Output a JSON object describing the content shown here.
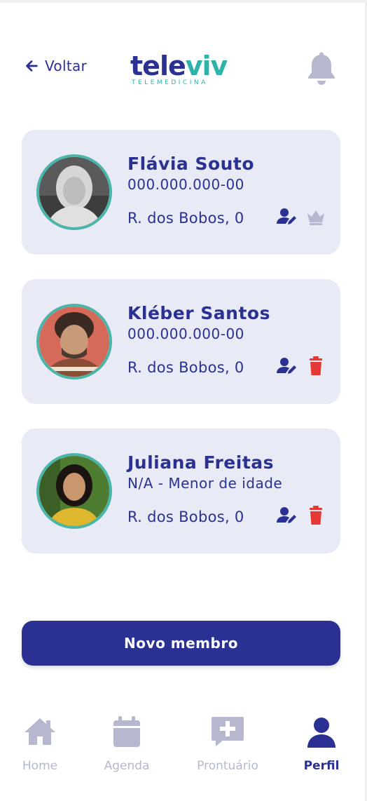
{
  "header": {
    "back_label": "Voltar",
    "logo_main_1": "tele",
    "logo_main_2": "viv",
    "logo_sub": "TELEMEDICINA"
  },
  "members": [
    {
      "name": "Flávia Souto",
      "document": "000.000.000-00",
      "address": "R. dos Bobos, 0",
      "actions": [
        "edit-user-icon",
        "crown-icon"
      ]
    },
    {
      "name": "Kléber Santos",
      "document": "000.000.000-00",
      "address": "R. dos Bobos, 0",
      "actions": [
        "edit-user-icon",
        "trash-icon"
      ]
    },
    {
      "name": "Juliana Freitas",
      "document": "N/A - Menor de idade",
      "address": "R. dos Bobos, 0",
      "actions": [
        "edit-user-icon",
        "trash-icon"
      ]
    }
  ],
  "new_member_label": "Novo membro",
  "nav": [
    {
      "label": "Home",
      "icon": "home-icon",
      "active": false
    },
    {
      "label": "Agenda",
      "icon": "calendar-icon",
      "active": false
    },
    {
      "label": "Prontuário",
      "icon": "medical-chat-icon",
      "active": false
    },
    {
      "label": "Perfil",
      "icon": "user-icon",
      "active": true
    }
  ],
  "colors": {
    "primary": "#2a3192",
    "accent": "#4bb5aa",
    "card_bg": "#e8eaf5",
    "danger": "#e53935",
    "inactive": "#b5b8cf"
  }
}
